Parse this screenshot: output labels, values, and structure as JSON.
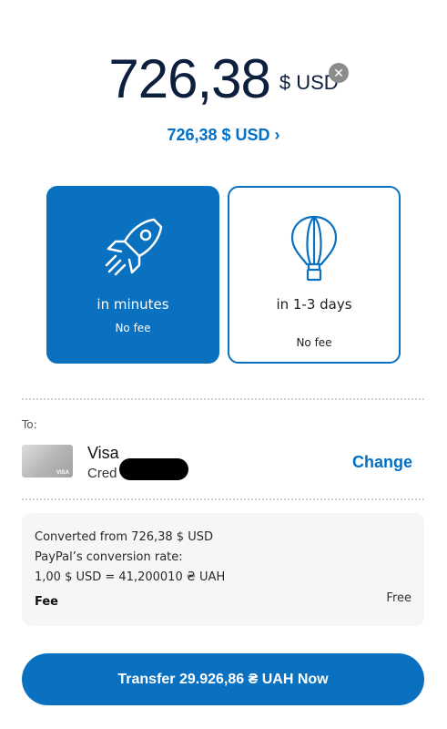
{
  "amount": {
    "value": "726,38",
    "currency": "$ USD",
    "clear_icon": "close-icon"
  },
  "converted_link": "726,38 $ USD ›",
  "speed_options": [
    {
      "icon": "rocket-icon",
      "title": "in minutes",
      "fee": "No fee",
      "selected": true
    },
    {
      "icon": "hot-air-balloon-icon",
      "title": "in 1-3 days",
      "fee": "No fee",
      "selected": false
    }
  ],
  "recipient": {
    "label": "To:",
    "card_name": "Visa",
    "card_type": "Cred",
    "card_brand": "VISA",
    "change_label": "Change"
  },
  "conversion": {
    "line1": "Converted from 726,38 $ USD",
    "line2": "PayPal’s conversion rate:",
    "line3": "1,00 $ USD = 41,200010 ₴ UAH",
    "fee_label": "Fee",
    "fee_value": "Free"
  },
  "transfer_button": "Transfer 29.926,86 ₴ UAH Now",
  "colors": {
    "accent": "#0a70c0",
    "link": "#0070c9",
    "amount_text": "#0c1f3d",
    "info_bg": "#f5f6f8"
  }
}
